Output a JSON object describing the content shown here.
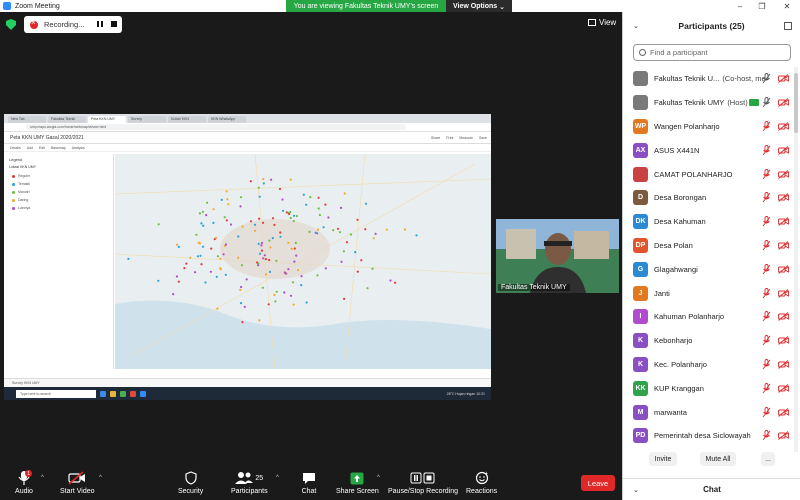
{
  "window": {
    "title": "Zoom Meeting"
  },
  "banner": {
    "text": "You are viewing Fakultas Teknik UMY's screen",
    "view_options": "View Options"
  },
  "recording": {
    "label": "Recording..."
  },
  "view_button": {
    "label": "View"
  },
  "shared_screen": {
    "browser_tabs": [
      "New Tab",
      "Fakultas Teknik",
      "Peta KKN UMY",
      "Survey",
      "Kuliah KKN",
      "KKN WhatsApp"
    ],
    "url": "umy.maps.arcgis.com/home/webmap/viewer.html",
    "app_title": "Peta KKN UMY Gasal 2020/2021",
    "app_right": [
      "Share",
      "Print",
      "Measure",
      "Save"
    ],
    "tools": [
      "Details",
      "Add",
      "Edit",
      "Basemap",
      "Analysis"
    ],
    "sidebar_title": "Legend",
    "legend_heading": "Lokasi KKN UMY",
    "legend_items": [
      {
        "label": "Reguler",
        "color": "#e23b3b"
      },
      {
        "label": "Tematik",
        "color": "#2aa3d9"
      },
      {
        "label": "Mandiri",
        "color": "#6bbf3f"
      },
      {
        "label": "Daring",
        "color": "#f3a92a"
      },
      {
        "label": "Lainnya",
        "color": "#b04bd0"
      }
    ],
    "bottom_tab": "Survey KKN UMY",
    "taskbar_search": "Type here to search",
    "taskbar_sys": "28°C Hujan ringan   10:21"
  },
  "speaker": {
    "name": "Fakultas Teknik UMY"
  },
  "toolbar": {
    "audio": "Audio",
    "start_video": "Start Video",
    "security": "Security",
    "participants": "Participants",
    "participants_count": "25",
    "chat": "Chat",
    "share_screen": "Share Screen",
    "pause_recording": "Pause/Stop Recording",
    "reactions": "Reactions",
    "leave": "Leave",
    "audio_badge": "1"
  },
  "panel": {
    "title": "Participants (25)",
    "search_placeholder": "Find a participant",
    "participants": [
      {
        "initials": "",
        "name": "Fakultas Teknik U...",
        "role": "(Co-host, me)",
        "color": "#7a7a7a",
        "img": true
      },
      {
        "initials": "",
        "name": "Fakultas Teknik UMY",
        "role": "(Host)",
        "color": "#7a7a7a",
        "img": true,
        "sharing": true
      },
      {
        "initials": "WP",
        "name": "Wangen Polanharjo",
        "role": "",
        "color": "#e3791f"
      },
      {
        "initials": "AX",
        "name": "ASUS X441N",
        "role": "",
        "color": "#8b4fc4"
      },
      {
        "initials": "",
        "name": "CAMAT POLANHARJO",
        "role": "",
        "color": "#c94343",
        "img": true
      },
      {
        "initials": "D",
        "name": "Desa Borongan",
        "role": "",
        "color": "#7b5a3e"
      },
      {
        "initials": "DK",
        "name": "Desa Kahuman",
        "role": "",
        "color": "#2a8ad2"
      },
      {
        "initials": "DP",
        "name": "Desa Polan",
        "role": "",
        "color": "#e0552b"
      },
      {
        "initials": "G",
        "name": "Glagahwangi",
        "role": "",
        "color": "#2a8ad2"
      },
      {
        "initials": "J",
        "name": "Janti",
        "role": "",
        "color": "#e3791f"
      },
      {
        "initials": "I",
        "name": "Kahuman Polanharjo",
        "role": "",
        "color": "#b04bd0"
      },
      {
        "initials": "K",
        "name": "Kebonharjo",
        "role": "",
        "color": "#8b4fc4"
      },
      {
        "initials": "K",
        "name": "Kec. Polanharjo",
        "role": "",
        "color": "#8b4fc4"
      },
      {
        "initials": "KK",
        "name": "KUP Kranggan",
        "role": "",
        "color": "#2ea34a"
      },
      {
        "initials": "M",
        "name": "marwanta",
        "role": "",
        "color": "#8b4fc4"
      },
      {
        "initials": "PD",
        "name": "Pemerintah desa Siclowayah",
        "role": "",
        "color": "#8b4fc4"
      }
    ],
    "invite": "Invite",
    "mute_all": "Mute All",
    "more": "...",
    "chat": "Chat"
  },
  "icons": {
    "shield": "shield-icon",
    "mic": "mic-muted-icon",
    "cam": "video-off-icon"
  }
}
